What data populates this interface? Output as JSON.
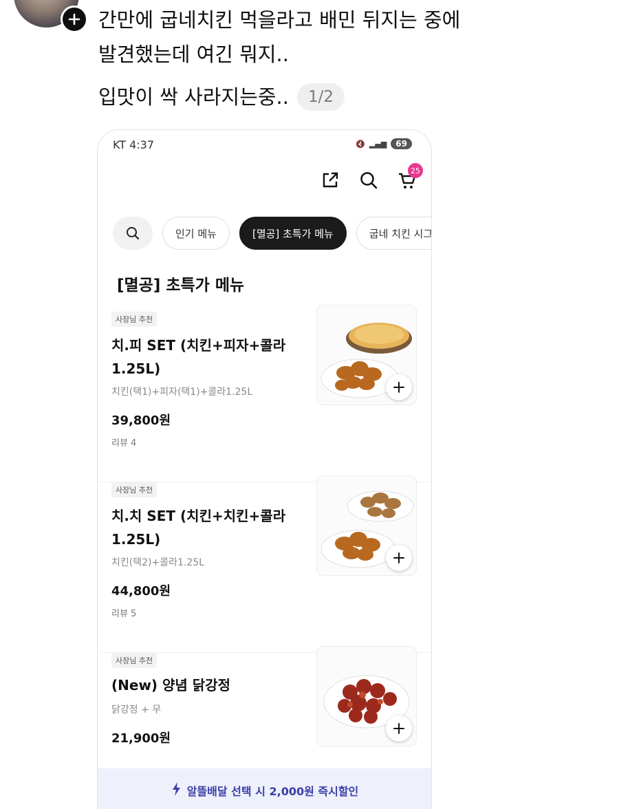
{
  "post": {
    "line1": "간만에 굽네치킨 먹을라고 배민 뒤지는 중에",
    "line1b": "발견했는데 여긴 뭐지..",
    "line2": "입맛이 싹 사라지는중..",
    "counter": "1/2"
  },
  "phone": {
    "status": {
      "carrier_time": "KT 4:37",
      "battery": "69"
    },
    "cart_count": "25",
    "chips": [
      "인기 메뉴",
      "[멸공] 초특가 메뉴",
      "굽네 치킨 시그"
    ],
    "section_title": "[멸공] 초특가 메뉴",
    "items": [
      {
        "tag": "사장님 추천",
        "name": "치.피 SET (치킨+피자+콜라1.25L)",
        "desc": "치킨(택1)+피자(택1)+콜라1.25L",
        "price": "39,800원",
        "review": "리뷰 4"
      },
      {
        "tag": "사장님 추천",
        "name": "치.치 SET (치킨+치킨+콜라1.25L)",
        "desc": "치킨(택2)+콜라1.25L",
        "price": "44,800원",
        "review": "리뷰 5"
      },
      {
        "tag": "사장님 추천",
        "name": "(New) 양념 닭강정",
        "desc": "닭강정 + 무",
        "price": "21,900원",
        "review": ""
      }
    ],
    "promo": "알뜰배달 선택 시 2,000원 즉시할인"
  },
  "colors": {
    "accent_pink": "#e6398f",
    "promo_text": "#3b3fa8",
    "promo_bg": "#eef0fb"
  },
  "icons": [
    "follow-plus-icon",
    "share-icon",
    "search-icon",
    "cart-icon",
    "add-icon",
    "lightning-icon"
  ]
}
